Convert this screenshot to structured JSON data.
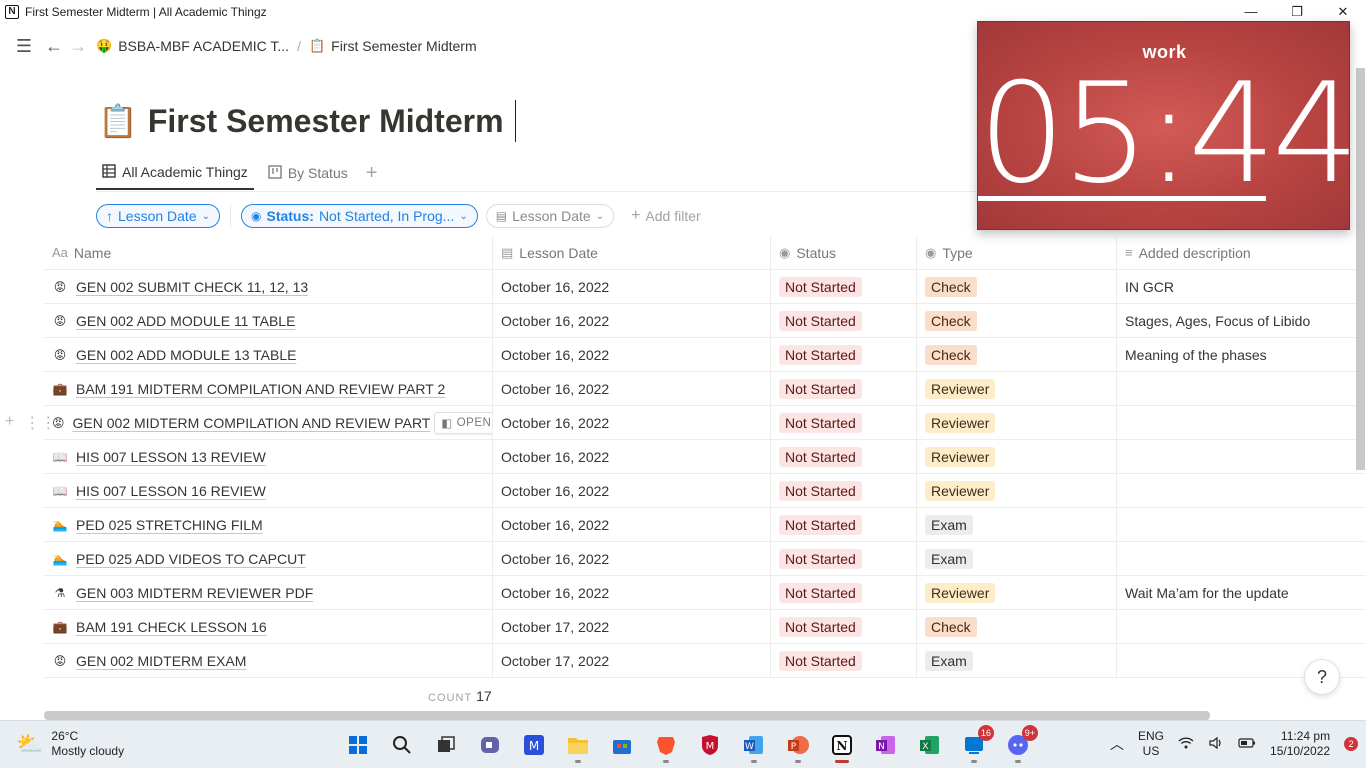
{
  "window": {
    "title": "First Semester Midterm | All Academic Thingz",
    "app_icon_letter": "N"
  },
  "nav": {
    "workspace": "BSBA-MBF ACADEMIC T...",
    "workspace_icon": "🤑",
    "page": "First Semester Midterm",
    "page_icon": "📋",
    "separator": "/"
  },
  "page": {
    "icon": "📋",
    "title": "First Semester Midterm"
  },
  "views": {
    "tabs": [
      {
        "label": "All Academic Thingz",
        "icon": "table-icon"
      },
      {
        "label": "By Status",
        "icon": "board-icon"
      }
    ],
    "add_icon": "+"
  },
  "filters": {
    "sort_label": "Lesson Date",
    "status_label": "Status:",
    "status_value": "Not Started, In Prog...",
    "date_filter_label": "Lesson Date",
    "add_filter_label": "Add filter"
  },
  "columns": [
    "Name",
    "Lesson Date",
    "Status",
    "Type",
    "Added description"
  ],
  "rows": [
    {
      "icon": "😡",
      "name": "GEN 002 SUBMIT CHECK 11, 12, 13",
      "date": "October 16, 2022",
      "status": "Not Started",
      "type": "Check",
      "desc": "IN GCR"
    },
    {
      "icon": "😡",
      "name": "GEN 002 ADD MODULE 11 TABLE",
      "date": "October 16, 2022",
      "status": "Not Started",
      "type": "Check",
      "desc": "Stages, Ages, Focus of Libido"
    },
    {
      "icon": "😡",
      "name": "GEN 002 ADD MODULE 13 TABLE",
      "date": "October 16, 2022",
      "status": "Not Started",
      "type": "Check",
      "desc": "Meaning of the phases"
    },
    {
      "icon": "💼",
      "name": "BAM 191 MIDTERM COMPILATION AND REVIEW PART 2",
      "date": "October 16, 2022",
      "status": "Not Started",
      "type": "Reviewer",
      "desc": ""
    },
    {
      "icon": "😡",
      "name": "GEN 002 MIDTERM COMPILATION AND REVIEW PART",
      "date": "October 16, 2022",
      "status": "Not Started",
      "type": "Reviewer",
      "desc": ""
    },
    {
      "icon": "📖",
      "name": "HIS 007 LESSON 13 REVIEW",
      "date": "October 16, 2022",
      "status": "Not Started",
      "type": "Reviewer",
      "desc": ""
    },
    {
      "icon": "📖",
      "name": "HIS 007 LESSON 16 REVIEW",
      "date": "October 16, 2022",
      "status": "Not Started",
      "type": "Reviewer",
      "desc": ""
    },
    {
      "icon": "🏊",
      "name": "PED 025 STRETCHING FILM",
      "date": "October 16, 2022",
      "status": "Not Started",
      "type": "Exam",
      "desc": ""
    },
    {
      "icon": "🏊",
      "name": "PED 025 ADD VIDEOS TO CAPCUT",
      "date": "October 16, 2022",
      "status": "Not Started",
      "type": "Exam",
      "desc": ""
    },
    {
      "icon": "⚗",
      "name": "GEN 003 MIDTERM REVIEWER PDF",
      "date": "October 16, 2022",
      "status": "Not Started",
      "type": "Reviewer",
      "desc": "Wait Ma’am for the update"
    },
    {
      "icon": "💼",
      "name": "BAM 191 CHECK LESSON 16",
      "date": "October 17, 2022",
      "status": "Not Started",
      "type": "Check",
      "desc": ""
    },
    {
      "icon": "😡",
      "name": "GEN 002 MIDTERM EXAM",
      "date": "October 17, 2022",
      "status": "Not Started",
      "type": "Exam",
      "desc": ""
    }
  ],
  "hover": {
    "open_label": "OPEN"
  },
  "footer": {
    "count_label": "COUNT",
    "count_value": "17"
  },
  "help_label": "?",
  "timer": {
    "label": "work",
    "time": "05:44"
  },
  "taskbar": {
    "weather_temp": "26°C",
    "weather_desc": "Mostly cloudy",
    "lang": "ENG",
    "region": "US",
    "time": "11:24 pm",
    "date": "15/10/2022",
    "notification_count": "2",
    "badge_teams": "16",
    "badge_discord": "9+"
  }
}
